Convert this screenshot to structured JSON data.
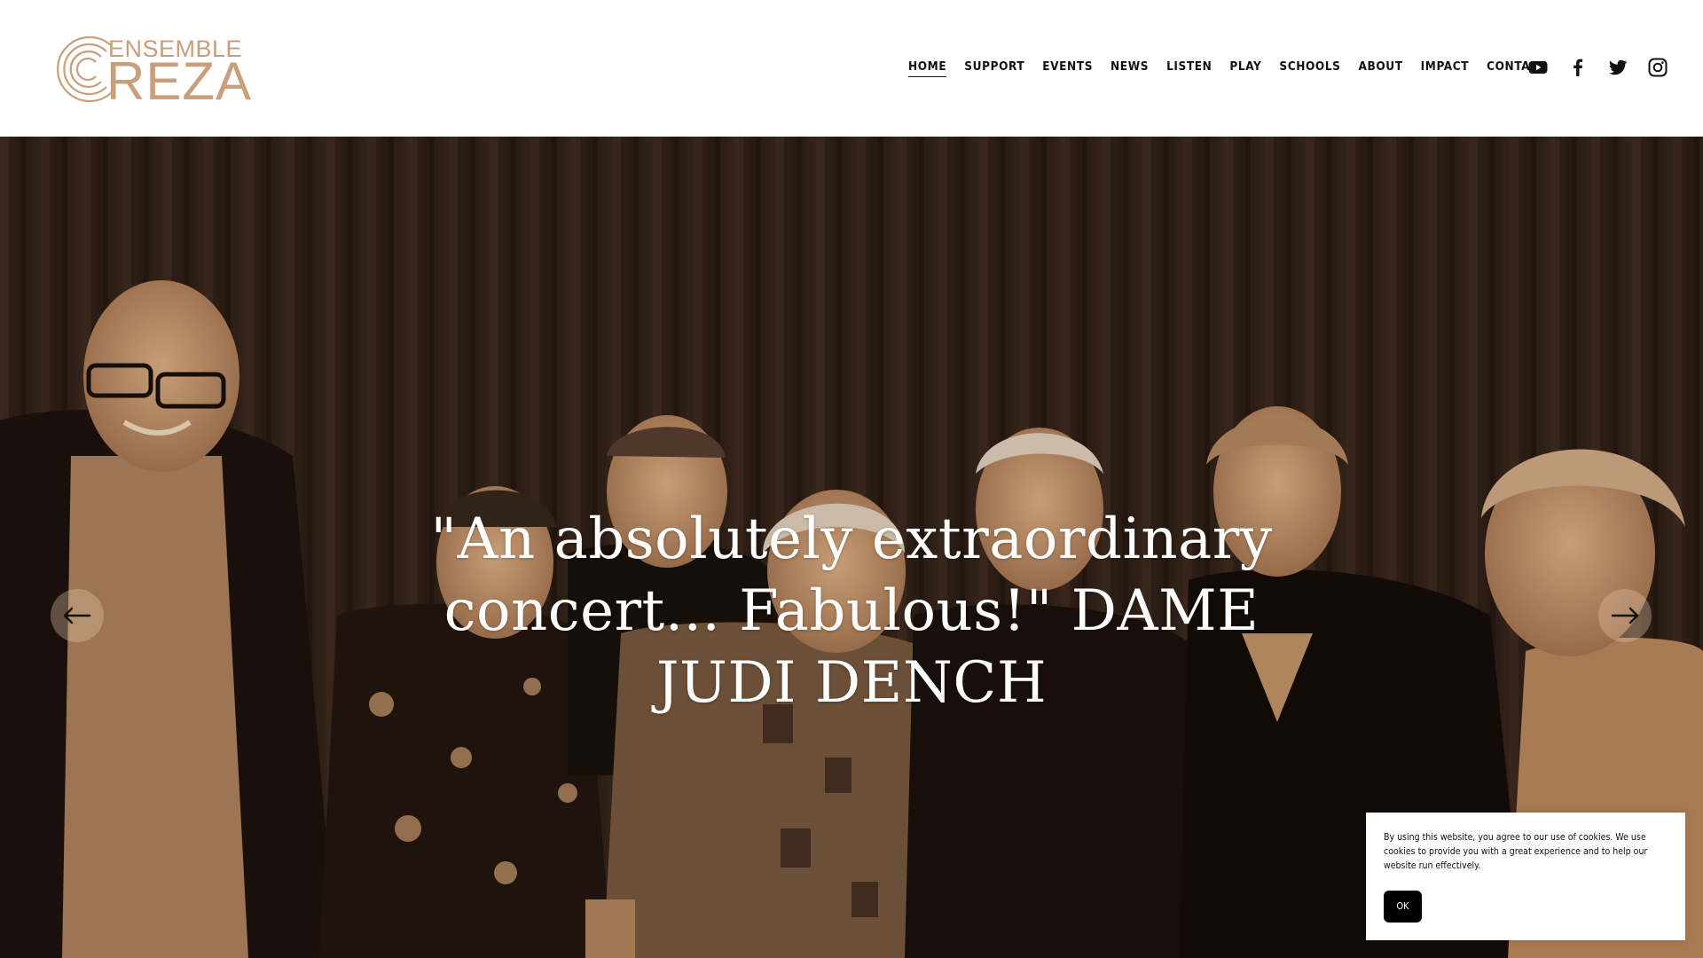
{
  "brand": {
    "line1": "ENSEMBLE",
    "line2": "REZA",
    "logo_letter": "C",
    "color": "#c89f7a"
  },
  "nav": {
    "items": [
      {
        "label": "HOME",
        "active": true
      },
      {
        "label": "SUPPORT"
      },
      {
        "label": "EVENTS"
      },
      {
        "label": "NEWS"
      },
      {
        "label": "LISTEN"
      },
      {
        "label": "PLAY"
      },
      {
        "label": "SCHOOLS"
      },
      {
        "label": "ABOUT"
      },
      {
        "label": "IMPACT"
      },
      {
        "label": "CONTACT"
      }
    ]
  },
  "social": {
    "icons": [
      "youtube-icon",
      "facebook-icon",
      "twitter-icon",
      "instagram-icon"
    ]
  },
  "hero": {
    "quote": "\"An absolutely extraordinary concert... Fabulous!\" DAME JUDI DENCH",
    "image_tone": "sepia group photo of seven smiling people in front of a dark curtain",
    "prev_icon": "arrow-left-icon",
    "next_icon": "arrow-right-icon"
  },
  "cookie": {
    "text": "By using this website, you agree to our use of cookies. We use cookies to provide you with a great experience and to help our website run effectively.",
    "ok_label": "OK"
  },
  "colors": {
    "accent": "#c89f7a",
    "text": "#111111",
    "hero_dark": "#2a1c14",
    "hero_light": "#c8986b"
  }
}
